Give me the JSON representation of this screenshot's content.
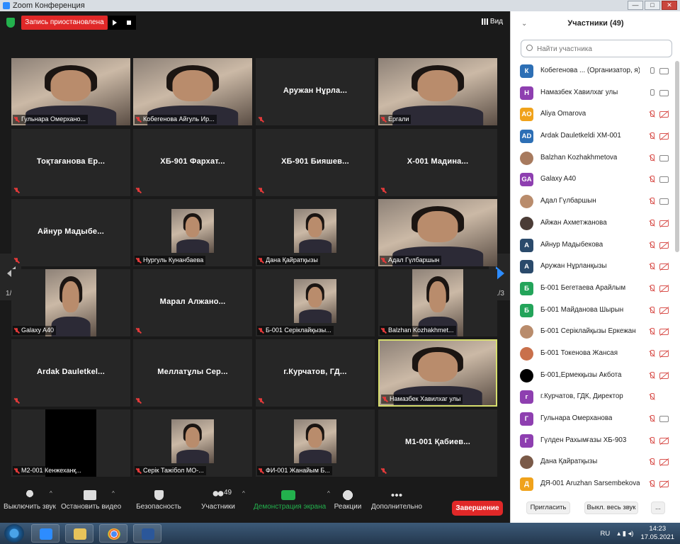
{
  "window": {
    "title": "Zoom Конференция",
    "buttons": [
      "—",
      "□",
      "✕"
    ]
  },
  "recording": {
    "label": "Запись приостановлена"
  },
  "view": {
    "label": "Вид"
  },
  "tiles": [
    {
      "caption": "Гульнара Омерхано...",
      "video": true
    },
    {
      "caption": "Кобегенова Айгуль Ир...",
      "video": true
    },
    {
      "name": "Аружан Нұрла...",
      "caption": ""
    },
    {
      "caption": "Ергали",
      "video": true
    },
    {
      "name": "Тоқтағанова Ер...",
      "caption": ""
    },
    {
      "name": "ХБ-901 Фархат...",
      "caption": ""
    },
    {
      "name": "ХБ-901 Бияшев...",
      "caption": ""
    },
    {
      "name": "Х-001 Мадина...",
      "caption": ""
    },
    {
      "name": "Айнур Мадыбе...",
      "caption": ""
    },
    {
      "caption": "Нургуль Кунанбаева",
      "video": true
    },
    {
      "caption": "Дана Қайратқызы",
      "video": true
    },
    {
      "caption": "Адал Гүлбаршын",
      "video": true
    },
    {
      "caption": "Galaxy A40",
      "video": true
    },
    {
      "name": "Марал Алжано...",
      "caption": ""
    },
    {
      "caption": "Б-001 Серiклайқызы...",
      "video": true
    },
    {
      "caption": "Balzhan Kozhakhmet...",
      "video": true
    },
    {
      "name": "Ardak Dauletkel...",
      "caption": ""
    },
    {
      "name": "Меллатұлы Сер...",
      "caption": ""
    },
    {
      "name": "г.Курчатов, ГД...",
      "caption": ""
    },
    {
      "caption": "Намазбек Хавилхаг улы",
      "video": true,
      "active": true
    },
    {
      "caption": "М2-001 Кенжеханқ...",
      "video": true,
      "dark": true
    },
    {
      "caption": "Серік Тажібол МО-...",
      "video": true
    },
    {
      "caption": "ФИ-001 Жанайым Б...",
      "video": true
    },
    {
      "name": "М1-001 Қабиев...",
      "caption": ""
    }
  ],
  "pager": {
    "left": "1/3",
    "right": "1/3"
  },
  "toolbar": {
    "mute": "Выключить звук",
    "video": "Остановить видео",
    "security": "Безопасность",
    "participants": "Участники",
    "participants_count": "49",
    "share": "Демонстрация экрана",
    "reactions": "Реакции",
    "more": "Дополнительно",
    "end": "Завершение"
  },
  "panel": {
    "title": "Участники (49)",
    "search_placeholder": "Найти участника",
    "footer": {
      "invite": "Пригласить",
      "mute_all": "Выкл. весь звук",
      "more": "..."
    }
  },
  "participants": [
    {
      "initials": "К",
      "color": "#2d6fb5",
      "name": "Кобегенова ... (Организатор, я)",
      "mic": "on",
      "cam": "on"
    },
    {
      "initials": "Н",
      "color": "#8e3fb0",
      "name": "Намазбек Хавилхаг улы",
      "mic": "on",
      "cam": "on"
    },
    {
      "initials": "AO",
      "color": "#f0a21b",
      "name": "Aliya Omarova",
      "mic": "off",
      "cam": "off"
    },
    {
      "initials": "AD",
      "color": "#2d6fb5",
      "name": "Ardak Dauletkeldi  ХМ-001",
      "mic": "off",
      "cam": "off"
    },
    {
      "initials": "",
      "color": "#a77a5e",
      "name": "Balzhan Kozhakhmetova",
      "mic": "off",
      "cam": "on"
    },
    {
      "initials": "GA",
      "color": "#8e3fb0",
      "name": "Galaxy A40",
      "mic": "off",
      "cam": "on"
    },
    {
      "initials": "",
      "color": "#b98c6c",
      "name": "Адал Гүлбаршын",
      "mic": "off",
      "cam": "on"
    },
    {
      "initials": "",
      "color": "#4b3c36",
      "name": "Айжан Ахметжанова",
      "mic": "off",
      "cam": "off"
    },
    {
      "initials": "А",
      "color": "#2a4a6b",
      "name": "Айнур Мадыбекова",
      "mic": "off",
      "cam": "off"
    },
    {
      "initials": "А",
      "color": "#2a4a6b",
      "name": "Аружан Нұрланқызы",
      "mic": "off",
      "cam": "off"
    },
    {
      "initials": "Б",
      "color": "#23a45a",
      "name": "Б-001 Бегетаева Арайлым",
      "mic": "off",
      "cam": "off"
    },
    {
      "initials": "Б",
      "color": "#23a45a",
      "name": "Б-001 Майданова Шырын",
      "mic": "off",
      "cam": "off"
    },
    {
      "initials": "",
      "color": "#b98c6c",
      "name": "Б-001 Серiклайқызы Еркежан",
      "mic": "off",
      "cam": "off"
    },
    {
      "initials": "",
      "color": "#c9704b",
      "name": "Б-001 Токенова Жансая",
      "mic": "off",
      "cam": "off"
    },
    {
      "initials": "",
      "color": "#000000",
      "name": "Б-001,Ермекқызы Акбота",
      "mic": "off",
      "cam": "off"
    },
    {
      "initials": "г",
      "color": "#8e3fb0",
      "name": "г.Курчатов, ГДК, Директор",
      "mic": "off",
      "cam": "none"
    },
    {
      "initials": "Г",
      "color": "#8e3fb0",
      "name": "Гульнара Омерханова",
      "mic": "off",
      "cam": "on"
    },
    {
      "initials": "Г",
      "color": "#8e3fb0",
      "name": "Гүлден Рахымғазы ХБ-903",
      "mic": "off",
      "cam": "off"
    },
    {
      "initials": "",
      "color": "#7a5a48",
      "name": "Дана Қайратқызы",
      "mic": "off",
      "cam": "off"
    },
    {
      "initials": "Д",
      "color": "#f0a21b",
      "name": "ДЯ-001 Aruzhan Sarsembekova",
      "mic": "off",
      "cam": "off"
    }
  ],
  "taskbar": {
    "lang": "RU",
    "time": "14:23",
    "date": "17.05.2021"
  }
}
